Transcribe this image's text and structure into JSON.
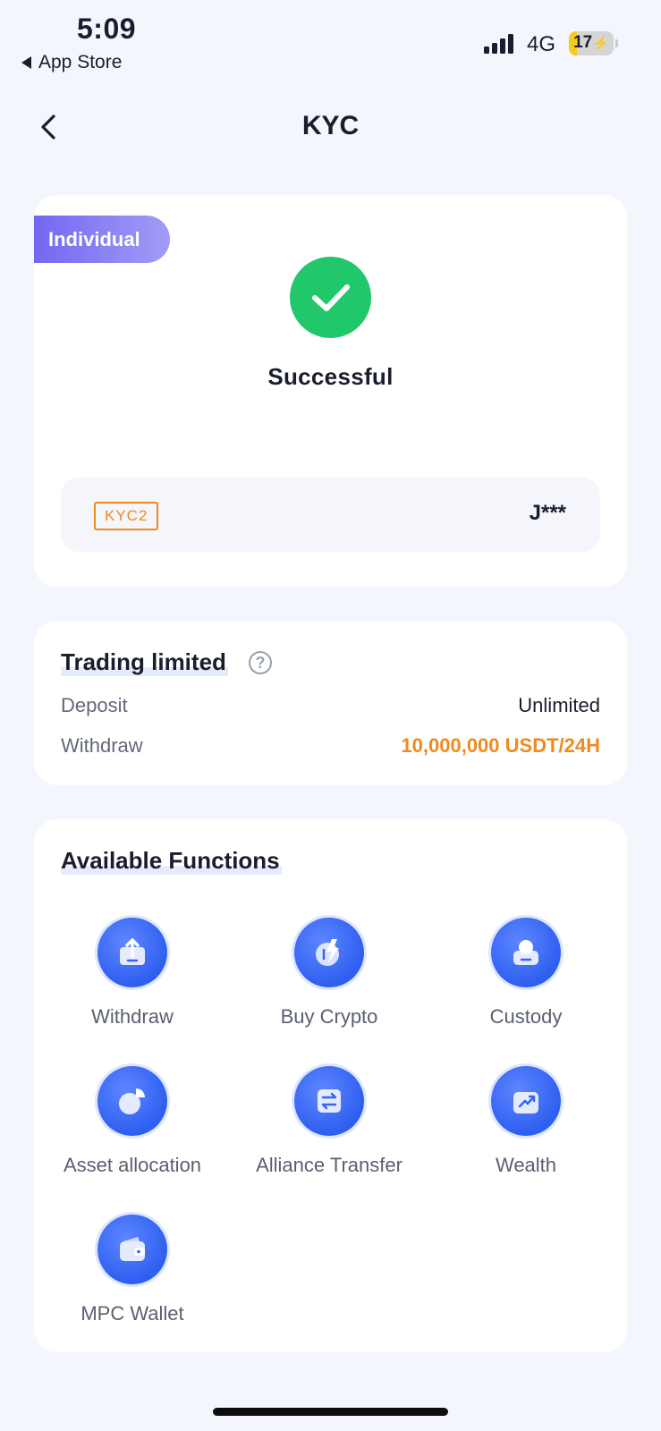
{
  "status_bar": {
    "time": "5:09",
    "back_app": "App Store",
    "network": "4G",
    "battery": "17",
    "battery_level": 0.17
  },
  "nav": {
    "title": "KYC"
  },
  "kyc_card": {
    "type_badge": "Individual",
    "status": "Successful",
    "level": "KYC2",
    "name": "J***"
  },
  "trading": {
    "title": "Trading limited",
    "rows": [
      {
        "label": "Deposit",
        "value": "Unlimited"
      },
      {
        "label": "Withdraw",
        "value": "10,000,000 USDT/24H"
      }
    ]
  },
  "functions": {
    "title": "Available Functions",
    "items": [
      {
        "label": "Withdraw",
        "icon": "withdraw-icon"
      },
      {
        "label": "Buy Crypto",
        "icon": "buy-crypto-icon"
      },
      {
        "label": "Custody",
        "icon": "custody-icon"
      },
      {
        "label": "Asset allocation",
        "icon": "asset-allocation-icon"
      },
      {
        "label": "Alliance Transfer",
        "icon": "alliance-transfer-icon"
      },
      {
        "label": "Wealth",
        "icon": "wealth-icon"
      },
      {
        "label": "MPC Wallet",
        "icon": "wallet-icon"
      }
    ]
  },
  "colors": {
    "accent_blue": "#3a63f5",
    "success_green": "#21c76b",
    "warning_orange": "#f08a1e",
    "badge_purple": "#7467f2"
  }
}
